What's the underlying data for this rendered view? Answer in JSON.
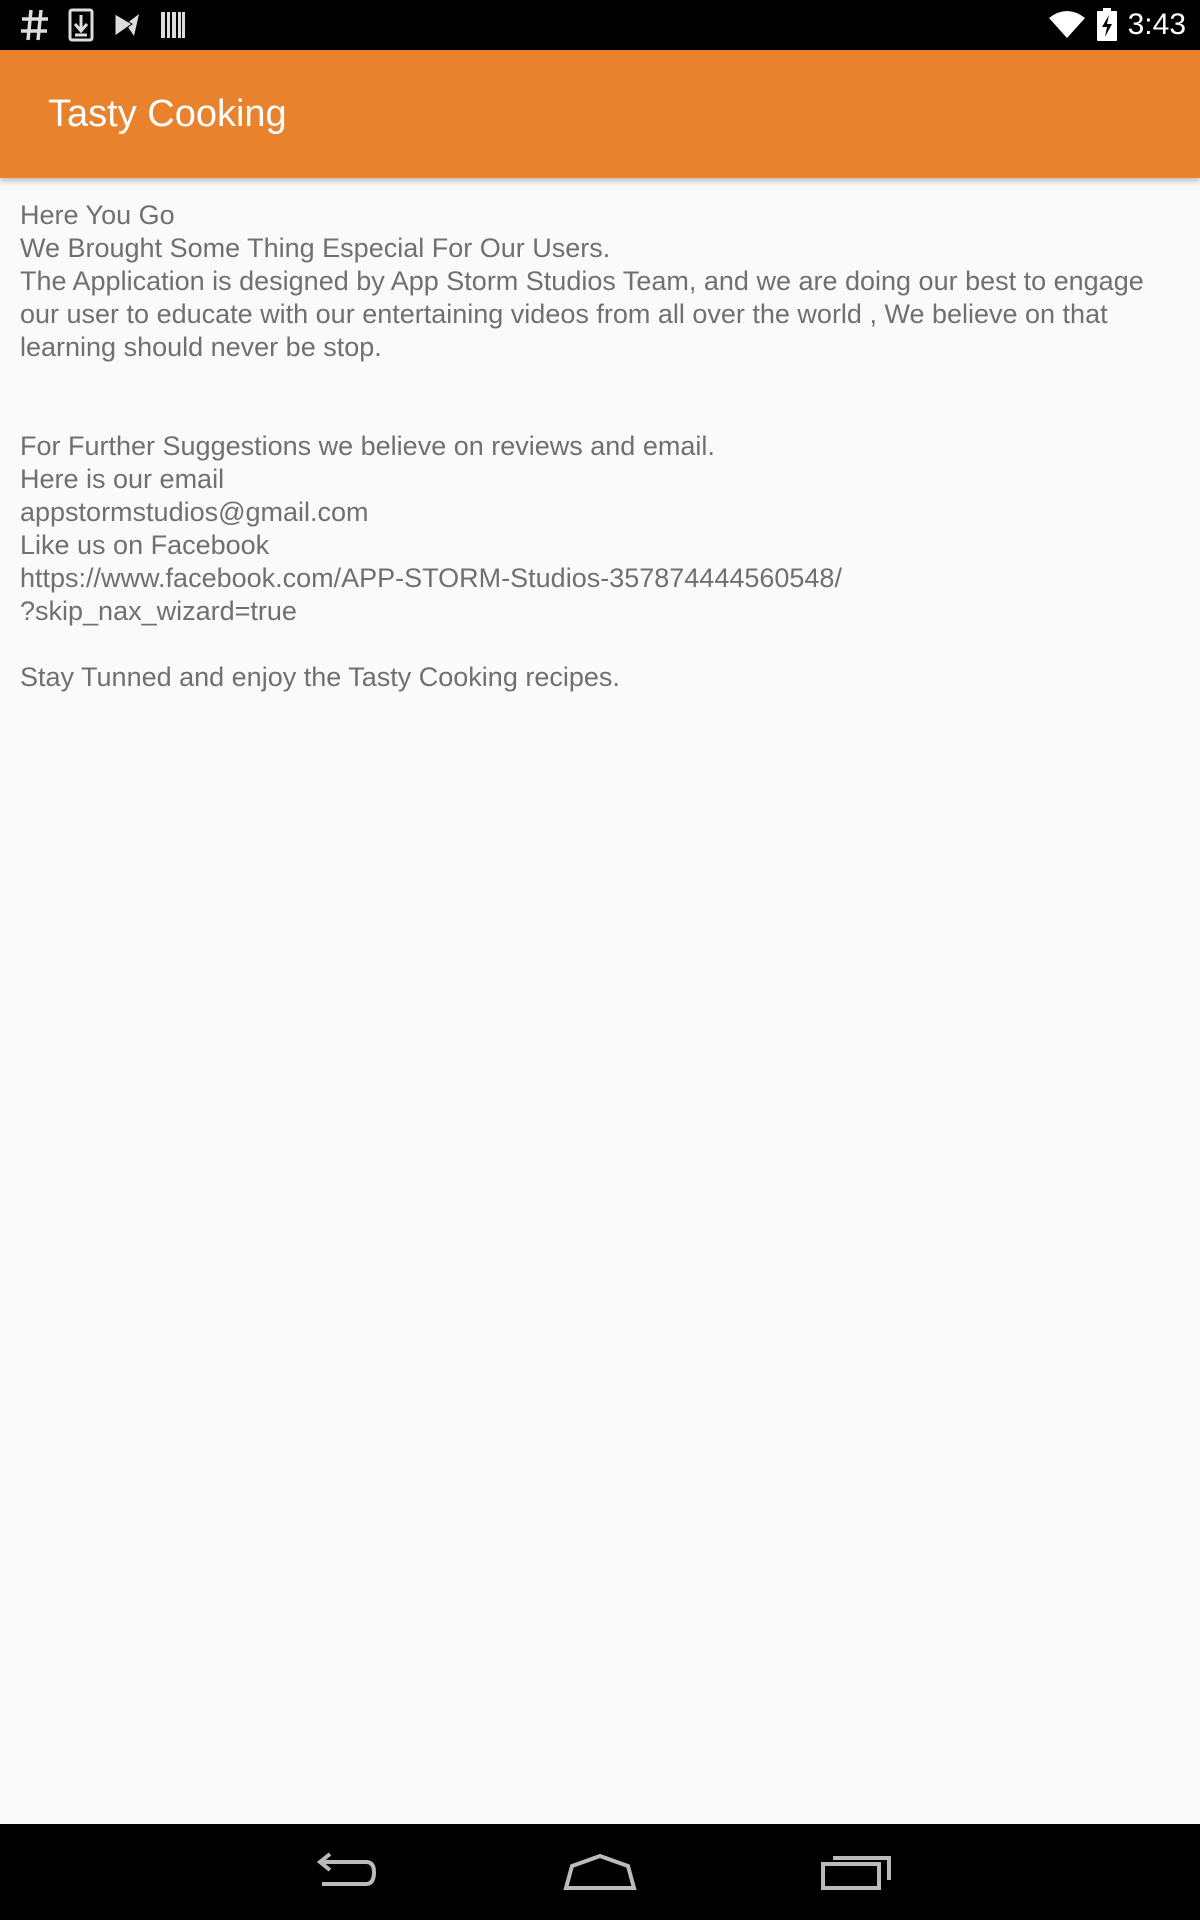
{
  "status_bar": {
    "time": "3:43",
    "left_icons": [
      "hash-icon",
      "download-icon",
      "play-store-icon",
      "barcode-icon"
    ],
    "right_icons": [
      "wifi-icon",
      "battery-charging-icon"
    ]
  },
  "app_bar": {
    "title": "Tasty Cooking",
    "color": "#e8822d"
  },
  "content": {
    "line1": "Here You Go",
    "line2": "We Brought Some Thing Especial For Our Users.",
    "paragraph": "The Application is designed by App Storm Studios Team, and we are doing our best to engage our user to educate with our entertaining videos from all over the world , We believe on that learning should never be stop.",
    "suggestions": "For Further Suggestions we believe on reviews and email.",
    "email_label": "Here is our email",
    "email": "appstormstudios@gmail.com",
    "facebook_label": "Like us on Facebook",
    "facebook_url_line1": "https://www.facebook.com/APP-STORM-Studios-357874444560548/",
    "facebook_url_line2": "?skip_nax_wizard=true",
    "closing": "Stay Tunned and enjoy the Tasty Cooking recipes."
  },
  "nav_bar": {
    "buttons": [
      "back-icon",
      "home-icon",
      "recents-icon"
    ]
  }
}
